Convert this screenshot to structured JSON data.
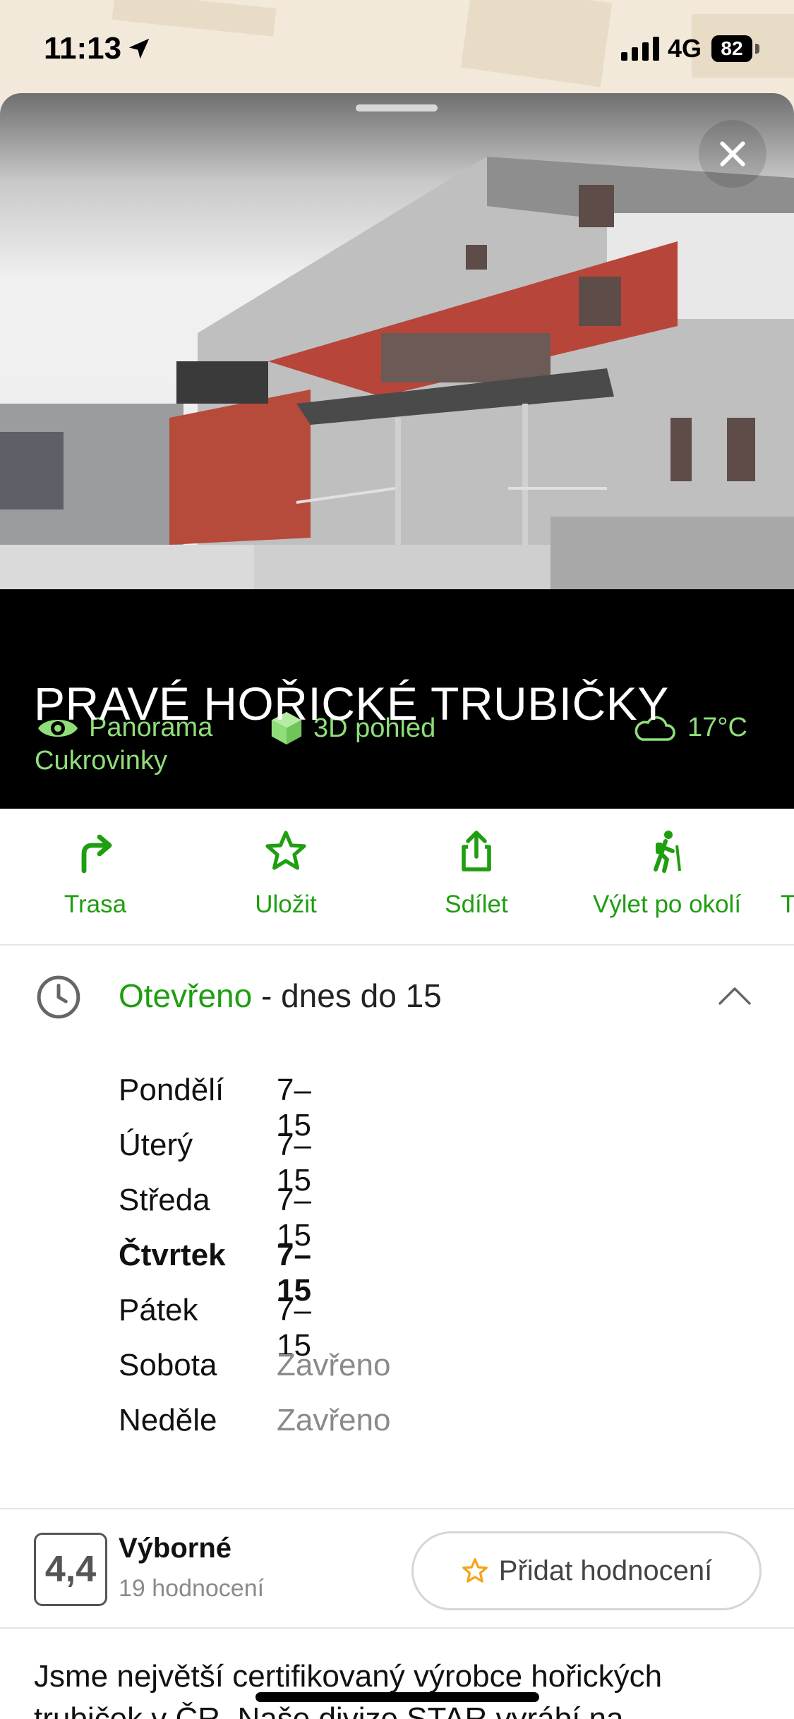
{
  "status_bar": {
    "time": "11:13",
    "network": "4G",
    "battery": "82"
  },
  "place": {
    "chips": {
      "panorama": "Panorama",
      "view3d": "3D pohled",
      "weather": "17°C"
    },
    "title": "PRAVÉ HOŘICKÉ TRUBIČKY",
    "category": "Cukrovinky"
  },
  "actions": [
    {
      "label": "Trasa",
      "icon": "route-arrow-icon"
    },
    {
      "label": "Uložit",
      "icon": "star-icon"
    },
    {
      "label": "Sdílet",
      "icon": "share-icon"
    },
    {
      "label": "Výlet po okolí",
      "icon": "hiker-icon"
    },
    {
      "label": "T",
      "icon": ""
    }
  ],
  "hours": {
    "status": "Otevřeno",
    "status_detail": " - dnes do 15",
    "days": [
      {
        "day": "Pondělí",
        "value": "7–15",
        "today": false,
        "closed": false
      },
      {
        "day": "Úterý",
        "value": "7–15",
        "today": false,
        "closed": false
      },
      {
        "day": "Středa",
        "value": "7–15",
        "today": false,
        "closed": false
      },
      {
        "day": "Čtvrtek",
        "value": "7–15",
        "today": true,
        "closed": false
      },
      {
        "day": "Pátek",
        "value": "7–15",
        "today": false,
        "closed": false
      },
      {
        "day": "Sobota",
        "value": "Zavřeno",
        "today": false,
        "closed": true
      },
      {
        "day": "Neděle",
        "value": "Zavřeno",
        "today": false,
        "closed": true
      }
    ]
  },
  "rating": {
    "score": "4,4",
    "label": "Výborné",
    "count": "19 hodnocení",
    "add_button": "Přidat hodnocení"
  },
  "description": "Jsme největší certifikovaný výrobce hořických trubiček v ČR. Naše divize STAR vyrábí na",
  "colors": {
    "accent_green": "#1f9e10",
    "chip_green": "#8fde7a",
    "star_orange": "#f2a516"
  }
}
